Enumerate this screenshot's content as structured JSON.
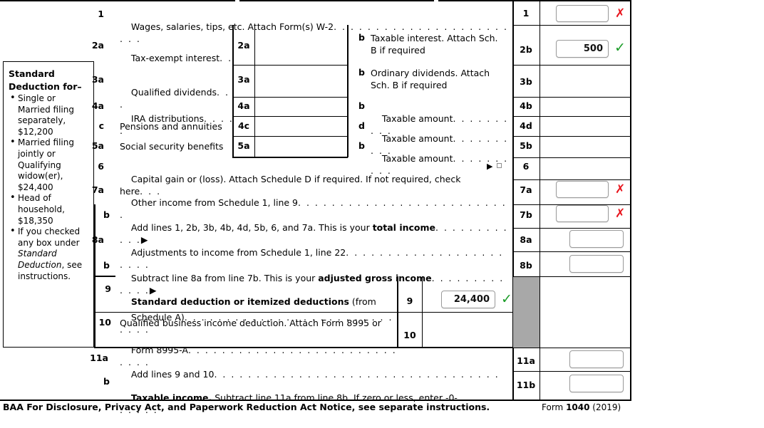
{
  "form": {
    "name": "Form 1040",
    "year": "2019",
    "footer_notice": "BAA For Disclosure, Privacy Act, and Paperwork Reduction Act Notice, see separate instructions.",
    "footer_form_prefix": "Form",
    "footer_form_number": "1040",
    "footer_form_year": "(2019)"
  },
  "colors": {
    "error": "#e8141c",
    "valid": "#1a9c27",
    "blocked_cell": "#a8a8a8",
    "rule": "#000000",
    "input_border": "#9a9a9a"
  },
  "sidebar": {
    "title_line1": "Standard",
    "title_line2": "Deduction for–",
    "items": [
      "Single or Married filing separately, $12,200",
      "Married filing jointly or Qualifying widow(er), $24,400",
      "Head of household, $18,350"
    ],
    "item4_prefix": "If you checked any box under ",
    "item4_italic": "Standard Deduction",
    "item4_suffix": ", see instructions."
  },
  "lines": {
    "l1": {
      "no": "1",
      "desc": "Wages, salaries, tips, etc. Attach Form(s) W-2",
      "leader": ". . . . . . . . . . . . . . . . . . . . . . . .",
      "box_no": "1",
      "value": "",
      "status": "invalid",
      "status_glyph": "✗"
    },
    "l2a": {
      "no": "2a",
      "desc": "Tax-exempt interest",
      "leader": ". .",
      "box_no": "2a",
      "value": ""
    },
    "l2b": {
      "no": "b",
      "desc": "Taxable interest. Attach Sch. B if required",
      "box_no": "2b",
      "value": "500",
      "status": "valid",
      "status_glyph": "✓"
    },
    "l3a": {
      "no": "3a",
      "desc": "Qualified dividends",
      "leader": ". . .",
      "box_no": "3a",
      "value": ""
    },
    "l3b": {
      "no": "b",
      "desc": "Ordinary dividends. Attach Sch. B if required",
      "box_no": "3b",
      "value": ""
    },
    "l4a": {
      "no": "4a",
      "desc": "IRA distributions",
      "leader": ". . . . .",
      "box_no": "4a",
      "value": ""
    },
    "l4b": {
      "no": "b",
      "desc": "Taxable amount",
      "leader": ". . . . . . . . . .",
      "box_no": "4b",
      "value": ""
    },
    "l4c": {
      "no": "c",
      "desc": "Pensions and annuities",
      "box_no": "4c",
      "value": ""
    },
    "l4d": {
      "no": "d",
      "desc": "Taxable amount",
      "leader": ". . . . . . . . . .",
      "box_no": "4d",
      "value": ""
    },
    "l5a": {
      "no": "5a",
      "desc": "Social security benefits",
      "box_no": "5a",
      "value": ""
    },
    "l5b": {
      "no": "b",
      "desc": "Taxable amount",
      "leader": ". . . . . . . . . .",
      "box_no": "5b",
      "value": ""
    },
    "l6": {
      "no": "6",
      "desc": "Capital gain or (loss). Attach Schedule D if required. If not required, check here",
      "leader": ". . .",
      "arrow": "▶",
      "checkbox_checked": false,
      "box_no": "6",
      "value": ""
    },
    "l7a": {
      "no": "7a",
      "desc": "Other income from Schedule 1, line 9",
      "leader": ". . . . . . . . . . . . . . . . . . . . . . . . . .",
      "box_no": "7a",
      "value": "",
      "status": "invalid",
      "status_glyph": "✗"
    },
    "l7b": {
      "no": "b",
      "desc_pre": "Add lines 1, 2b, 3b, 4b, 4d, 5b, 6, and 7a. This is your ",
      "desc_bold": "total income",
      "leader": ". . . . . . . . . . . .",
      "arrow": "▶",
      "box_no": "7b",
      "value": "",
      "status": "invalid",
      "status_glyph": "✗"
    },
    "l8a": {
      "no": "8a",
      "desc": "Adjustments to income from Schedule 1, line 22",
      "leader": ". . . . . . . . . . . . . . . . . . . . . . .",
      "box_no": "8a",
      "value": ""
    },
    "l8b": {
      "no": "b",
      "desc_pre": "Subtract line 8a from line 7b. This is your ",
      "desc_bold": "adjusted gross income",
      "leader": ". . . . . . . . . . . . .",
      "arrow": "▶",
      "box_no": "8b",
      "value": ""
    },
    "l9": {
      "no": "9",
      "desc_bold": "Standard deduction or itemized deductions",
      "desc_post": " (from",
      "desc_line2": "Schedule A)",
      "leader": ". . . . . . . . . . . . . . . . . . . . . . . . . . . . .",
      "box_no": "9",
      "value": "24,400",
      "status": "valid",
      "status_glyph": "✓"
    },
    "l10": {
      "no": "10",
      "desc_line1": "Qualified business income deduction. Attach Form 8995 or",
      "desc_line2": "Form 8995-A",
      "leader": ". . . . . . . . . . . . . . . . . . . . . . . . . . . . .",
      "box_no": "10",
      "value": ""
    },
    "l11a": {
      "no": "11a",
      "desc": "Add lines 9 and 10",
      "leader": ". . . . . . . . . . . . . . . . . . . . . . . . . . . . . . . . . .",
      "box_no": "11a",
      "value": ""
    },
    "l11b": {
      "no": "b",
      "desc_bold": "Taxable income.",
      "desc_post": " Subtract line 11a from line 8b. If zero or less, enter -0-",
      "leader": ". . . . . . . . . . .",
      "box_no": "11b",
      "value": ""
    }
  }
}
